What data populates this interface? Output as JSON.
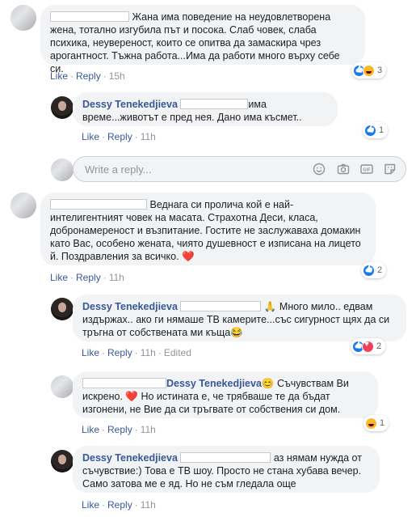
{
  "comments": [
    {
      "text": "Жана има поведение на неудовлетворена жена, тотално изгубила път и посока. Слаб човек, слаба психика, неувереност, които се опитва да замаскира чрез арогантност. Тъжна работа...Има да работи много върху себе си.",
      "actions": {
        "like": "Like",
        "reply": "Reply",
        "time": "15h"
      },
      "reaction_count": "3",
      "reactions": [
        "like",
        "haha"
      ]
    },
    {
      "author": "Dessy Tenekedjieva",
      "text": "има време...животът е пред нея. Дано има късмет..",
      "actions": {
        "like": "Like",
        "reply": "Reply",
        "time": "11h"
      },
      "reaction_count": "1",
      "reactions": [
        "like"
      ]
    },
    {
      "text": "Веднага си пролича кой е най-интелигентният човек на масата. Страхотна Деси, класа, добронамереност и възпитание. Гостите не заслужаваха домакин като Вас, особено жената, чиято душевност е изписана на лицето й. Поздравления за всичко. ❤️",
      "actions": {
        "like": "Like",
        "reply": "Reply",
        "time": "11h"
      },
      "reaction_count": "2",
      "reactions": [
        "like"
      ]
    },
    {
      "author": "Dessy Tenekedjieva",
      "text": "🙏 Много мило.. едвам издържах.. ако ги нямаше ТВ камерите...със сигурност щях да си тръгна от собствената ми къща😂",
      "actions": {
        "like": "Like",
        "reply": "Reply",
        "time": "11h",
        "edited": "Edited"
      },
      "reaction_count": "2",
      "reactions": [
        "like",
        "love"
      ]
    },
    {
      "mention": "Dessy Tenekedjieva",
      "text": "😊 Съчувствам Ви искрено. ❤️ Но истината е, че трябваше те да бъдат изгонени, не Вие да си тръгвате от собствения си дом.",
      "actions": {
        "like": "Like",
        "reply": "Reply",
        "time": "11h"
      },
      "reaction_count": "1",
      "reactions": [
        "haha"
      ]
    },
    {
      "author": "Dessy Tenekedjieva",
      "text": "аз нямам нужда от съчувствие:) Това е ТВ шоу. Просто не стана хубава вечер. Само затова ме е яд. Но не съм гледала още",
      "actions": {
        "like": "Like",
        "reply": "Reply",
        "time": "11h"
      }
    }
  ],
  "reply_box": {
    "placeholder": "Write a reply..."
  },
  "icons": [
    "emoji-icon",
    "camera-icon",
    "gif-icon",
    "sticker-icon"
  ],
  "colors": {
    "link": "#385898",
    "bubble": "#f2f3f5",
    "muted": "#90949c",
    "like": "#1877f2",
    "love": "#f33e58",
    "haha": "#f7b928"
  }
}
